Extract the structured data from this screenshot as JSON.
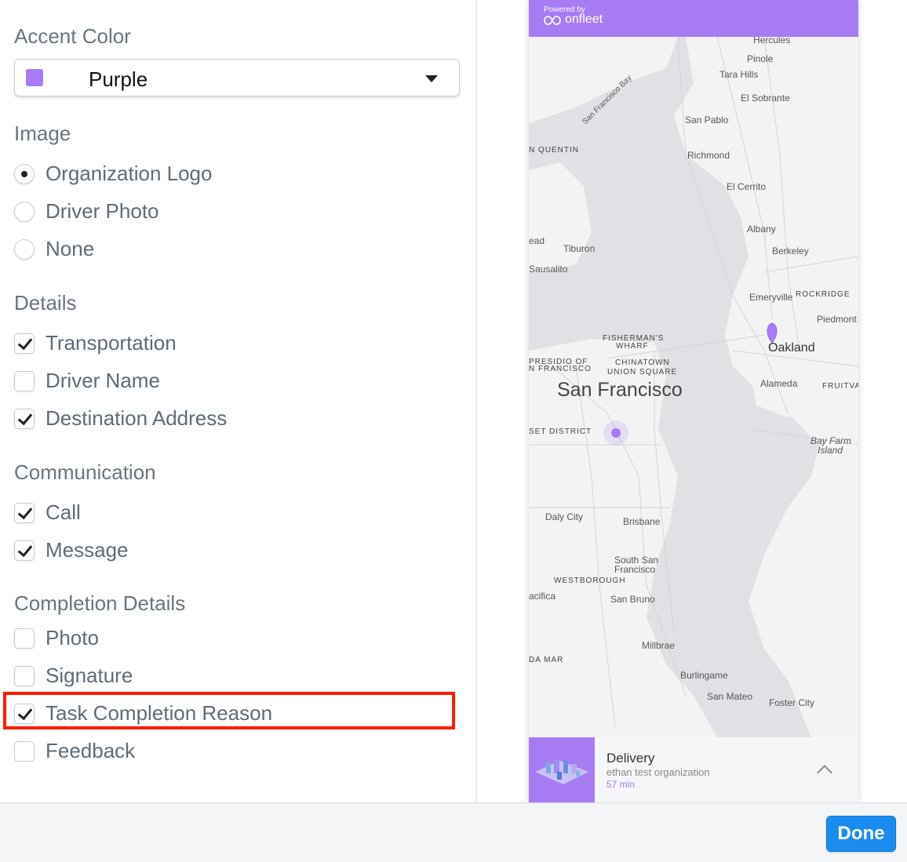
{
  "accent": {
    "title": "Accent Color",
    "selected": "Purple",
    "swatch_color": "#a77cf2"
  },
  "image": {
    "title": "Image",
    "options": [
      {
        "label": "Organization Logo",
        "selected": true
      },
      {
        "label": "Driver Photo",
        "selected": false
      },
      {
        "label": "None",
        "selected": false
      }
    ]
  },
  "details": {
    "title": "Details",
    "options": [
      {
        "label": "Transportation",
        "checked": true
      },
      {
        "label": "Driver Name",
        "checked": false
      },
      {
        "label": "Destination Address",
        "checked": true
      }
    ]
  },
  "communication": {
    "title": "Communication",
    "options": [
      {
        "label": "Call",
        "checked": true
      },
      {
        "label": "Message",
        "checked": true
      }
    ]
  },
  "completion": {
    "title": "Completion Details",
    "options": [
      {
        "label": "Photo",
        "checked": false
      },
      {
        "label": "Signature",
        "checked": false
      },
      {
        "label": "Task Completion Reason",
        "checked": true
      },
      {
        "label": "Feedback",
        "checked": false
      }
    ]
  },
  "preview": {
    "powered_by": "Powered by",
    "brand": "onfleet",
    "map_labels": {
      "hercules": "Hercules",
      "pinole": "Pinole",
      "tara_hills": "Tara Hills",
      "el_sobrante": "El Sobrante",
      "sf_bay": "San Francisco Bay",
      "san_pablo": "San Pablo",
      "san_quentin": "N QUENTIN",
      "richmond": "Richmond",
      "el_cerrito": "El Cerrito",
      "albany": "Albany",
      "berkeley": "Berkeley",
      "head": "ead",
      "tiburon": "Tiburon",
      "sausalito": "Sausalito",
      "emeryville": "Emeryville",
      "rockridge": "ROCKRIDGE",
      "piedmont": "Piedmont",
      "fishermans": "FISHERMAN'S",
      "wharf": "WHARF",
      "oakland": "Oakland",
      "presidio": "PRESIDIO OF",
      "presidio2": "N FRANCISCO",
      "chinatown": "CHINATOWN",
      "union_square": "UNION SQUARE",
      "san_francisco": "San Francisco",
      "alameda": "Alameda",
      "fruitvale": "FRUITVAL",
      "sunset": "SET DISTRICT",
      "bay_farm": "Bay Farm",
      "island": "Island",
      "daly_city": "Daly City",
      "brisbane": "Brisbane",
      "south_sf": "South San",
      "south_sf2": "Francisco",
      "westborough": "WESTBOROUGH",
      "pacifica": "acifica",
      "san_bruno": "San Bruno",
      "millbrae": "Millbrae",
      "da_mar": "DA MAR",
      "burlingame": "Burlingame",
      "san_mateo": "San Mateo",
      "foster_city": "Foster City"
    },
    "card": {
      "title": "Delivery",
      "org": "ethan test organization",
      "eta": "57 min"
    }
  },
  "footer": {
    "done_label": "Done"
  }
}
